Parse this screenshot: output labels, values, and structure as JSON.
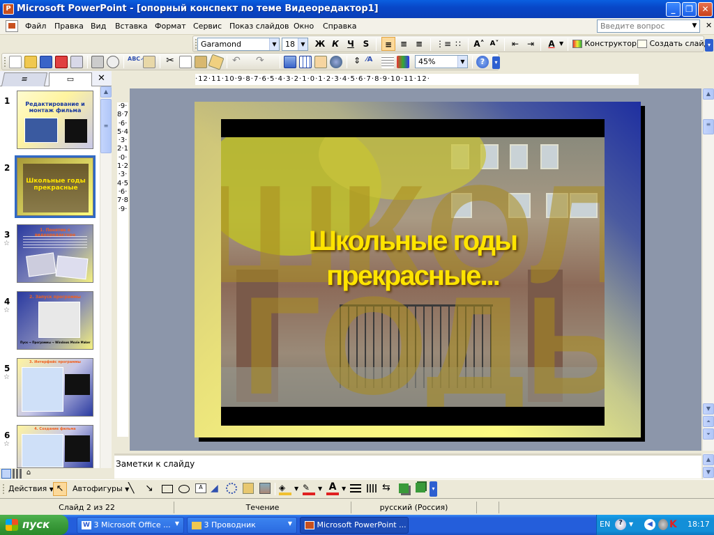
{
  "window": {
    "title": "Microsoft PowerPoint - [опорный конспект по теме Видеоредактор1]",
    "app_icon": "powerpoint-icon",
    "min_label": "_",
    "restore_label": "❐",
    "close_label": "✕"
  },
  "menu": {
    "items": [
      "Файл",
      "Правка",
      "Вид",
      "Вставка",
      "Формат",
      "Сервис",
      "Показ слайдов",
      "Окно",
      "Справка"
    ],
    "help_placeholder": "Введите вопрос"
  },
  "format_toolbar": {
    "font": "Garamond",
    "size": "18",
    "bold": "Ж",
    "italic": "К",
    "underline": "Ч",
    "shadow": "S",
    "font_color_label": "A",
    "designer_label": "Конструктор",
    "new_slide_label": "Создать слайд"
  },
  "standard_toolbar": {
    "zoom": "45%"
  },
  "left_panel": {
    "close_label": "✕",
    "thumbnails": [
      {
        "num": "1",
        "title": "Редактирование и монтаж фильма",
        "starred": false
      },
      {
        "num": "2",
        "title": "Школьные годы прекрасные",
        "starred": false,
        "selected": true
      },
      {
        "num": "3",
        "title": "1. Понятие о видеоредакторе",
        "starred": true
      },
      {
        "num": "4",
        "title": "2. Запуск программы",
        "starred": true
      },
      {
        "num": "5",
        "title": "3. Интерфейс программы",
        "starred": true
      },
      {
        "num": "6",
        "title": "4. Создание фильма",
        "starred": true
      }
    ],
    "thumb4_caption": "Пуск → Программы → Windows Movie Maker"
  },
  "ruler": {
    "horizontal": "·12·11·10·9·8·7·6·5·4·3·2·1·0·1·2·3·4·5·6·7·8·9·10·11·12·",
    "vertical": "·9·8·7·6·5·4·3·2·1·0·1·2·3·4·5·6·7·8·9·"
  },
  "slide": {
    "title_line1": "Школьные годы",
    "title_line2": "прекрасные..."
  },
  "notes": {
    "placeholder": "Заметки к слайду"
  },
  "draw_toolbar": {
    "actions_label": "Действия",
    "autoshapes_label": "Автофигуры",
    "text_color_label": "A"
  },
  "status": {
    "slide_info": "Слайд 2 из 22",
    "design": "Течение",
    "language": "русский (Россия)"
  },
  "taskbar": {
    "start_label": "пуск",
    "buttons": [
      "3 Microsoft Office ...",
      "3 Проводник",
      "Microsoft PowerPoint ..."
    ],
    "lang": "EN",
    "clock": "18:17"
  },
  "colors": {
    "titlebar": "#0a5fe0",
    "slide_title": "#ffe400",
    "taskbar": "#245edb",
    "start_button": "#3a9a3a"
  }
}
